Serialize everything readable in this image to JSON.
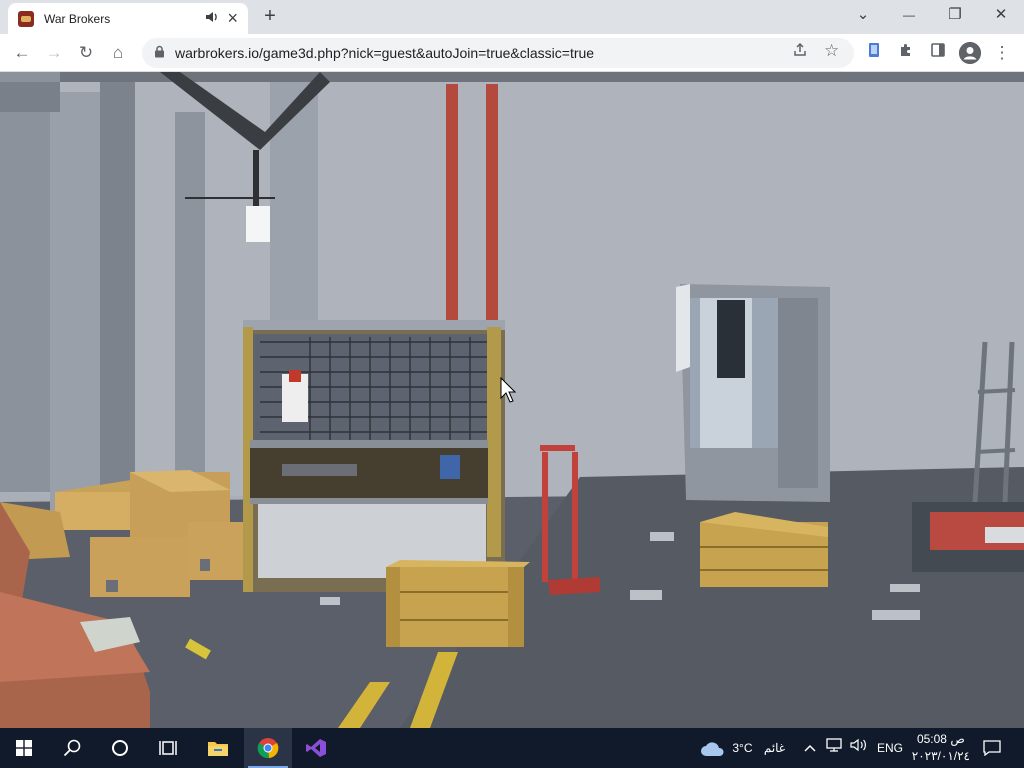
{
  "browser": {
    "tab_title": "War Brokers",
    "url": "warbrokers.io/game3d.php?nick=guest&autoJoin=true&classic=true",
    "accent": "#dee1e6"
  },
  "icons": {
    "favicon": "war-brokers-favicon",
    "audio": "speaker-icon",
    "close": "×",
    "new_tab": "+",
    "back": "←",
    "forward": "→",
    "reload": "↻",
    "home": "⌂",
    "lock": "🔒",
    "share": "⇪",
    "star": "☆",
    "extension": "✚",
    "sidepanel": "▯",
    "menu": "⋮",
    "minimize": "—",
    "maximize": "❐",
    "window_close": "✕",
    "tab_search": "⌄"
  },
  "taskbar": {
    "weather_temp": "3°C",
    "weather_text": "غائم",
    "lang": "ENG",
    "time": "05:08 ص",
    "date": "٢٠٢٣/٠١/٢٤"
  }
}
